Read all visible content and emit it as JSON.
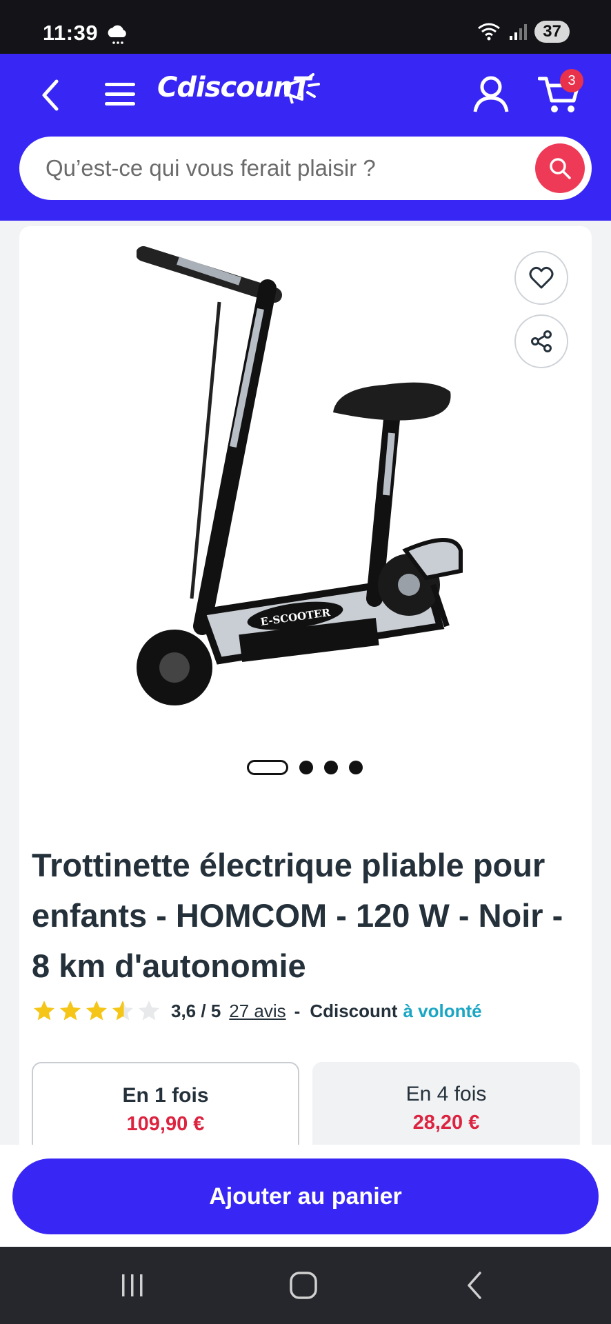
{
  "status_bar": {
    "time": "11:39",
    "battery": "37",
    "weather_icon": "cloud-rain-icon"
  },
  "header": {
    "logo_text": "CdiscounT",
    "cart_count": "3",
    "brand_color": "#3827f4"
  },
  "search": {
    "placeholder": "Qu’est-ce qui vous ferait plaisir ?"
  },
  "product": {
    "title": "Trottinette électrique pliable pour enfants - HOMCOM - 120 W - Noir - 8 km d'autonomie",
    "rating": 3.6,
    "rating_text": "3,6 / 5",
    "reviews": "27 avis",
    "separator": "-",
    "seller": "Cdiscount",
    "seller_suffix": "à volonté",
    "image_count": 4,
    "image_index": 1,
    "scooter_deck_text": "E-SCOOTER"
  },
  "payment": {
    "option_1": {
      "label": "En 1 fois",
      "price": "109,90 €"
    },
    "option_4": {
      "label": "En 4 fois",
      "price": "28,20 €"
    }
  },
  "cta": {
    "add_to_cart": "Ajouter au panier"
  },
  "colors": {
    "price": "#dc2340",
    "star": "#f5c518",
    "accent_teal": "#1ba6c4"
  }
}
